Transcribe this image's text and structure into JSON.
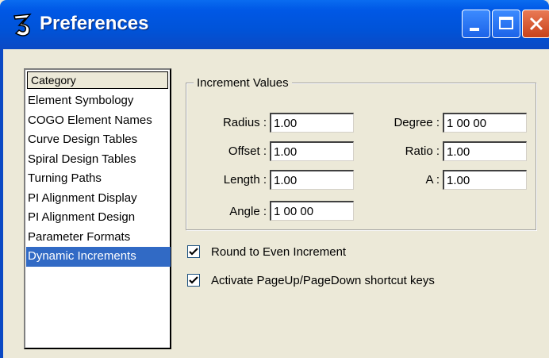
{
  "window": {
    "title": "Preferences",
    "accent": "#0053d8"
  },
  "category": {
    "header": "Category",
    "items": [
      "Element Symbology",
      "COGO Element Names",
      "Curve Design Tables",
      "Spiral Design Tables",
      "Turning Paths",
      "PI Alignment Display",
      "PI Alignment Design",
      "Parameter Formats",
      "Dynamic Increments"
    ],
    "selected": "Dynamic Increments"
  },
  "increments": {
    "title": "Increment Values",
    "radius_label": "Radius :",
    "radius_value": "1.00",
    "offset_label": "Offset :",
    "offset_value": "1.00",
    "length_label": "Length :",
    "length_value": "1.00",
    "angle_label": "Angle :",
    "angle_value": "1 00 00",
    "degree_label": "Degree :",
    "degree_value": "1 00 00",
    "ratio_label": "Ratio :",
    "ratio_value": "1.00",
    "a_label": "A :",
    "a_value": "1.00"
  },
  "options": {
    "round_label": "Round to Even Increment",
    "round_checked": true,
    "pageupdown_label": "Activate PageUp/PageDown shortcut keys",
    "pageupdown_checked": true
  }
}
